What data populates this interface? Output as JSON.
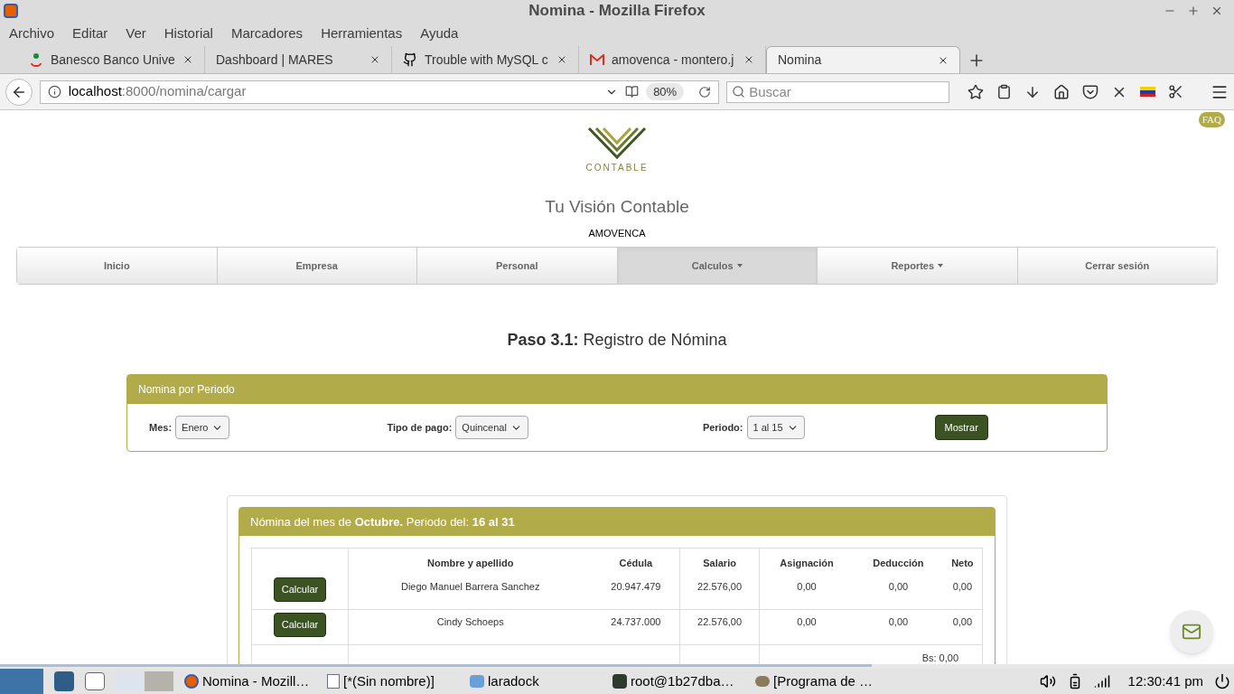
{
  "window": {
    "title": "Nomina - Mozilla Firefox"
  },
  "menu": [
    "Archivo",
    "Editar",
    "Ver",
    "Historial",
    "Marcadores",
    "Herramientas",
    "Ayuda"
  ],
  "tabs": [
    {
      "label": "Banesco Banco Unive",
      "kind": "bank",
      "selected": false
    },
    {
      "label": "Dashboard | MARES",
      "kind": "plain",
      "selected": false
    },
    {
      "label": "Trouble with MySQL c",
      "kind": "code",
      "selected": false
    },
    {
      "label": "amovenca - montero.j",
      "kind": "mail",
      "selected": false
    },
    {
      "label": "Nomina",
      "kind": "plain",
      "selected": true
    }
  ],
  "address_bar": {
    "host": "localhost",
    "path": ":8000/nomina/cargar",
    "zoom": "80%"
  },
  "search": {
    "placeholder": "Buscar"
  },
  "page": {
    "faq": "FAQ",
    "logo_text": "CONTABLE",
    "site_title": "Tu Visión Contable",
    "company": "AMOVENCA",
    "nav": [
      {
        "label": "Inicio",
        "dropdown": false,
        "selected": false
      },
      {
        "label": "Empresa",
        "dropdown": false,
        "selected": false
      },
      {
        "label": "Personal",
        "dropdown": false,
        "selected": false
      },
      {
        "label": "Calculos",
        "dropdown": true,
        "selected": true
      },
      {
        "label": "Reportes",
        "dropdown": true,
        "selected": false
      },
      {
        "label": "Cerrar sesión",
        "dropdown": false,
        "selected": false
      }
    ],
    "heading_bold": "Paso 3.1:",
    "heading": "Registro de Nómina",
    "filter_panel": {
      "title": "Nomina por Periodo",
      "fields": [
        {
          "label": "Mes:",
          "value": "Enero"
        },
        {
          "label": "Tipo de pago:",
          "value": "Quincenal"
        },
        {
          "label": "Periodo:",
          "value": "1 al 15"
        }
      ],
      "button": "Mostrar"
    },
    "results": {
      "title": "Nómina del mes de **Octubre.** Periodo del: **16 al 31**",
      "columns": [
        "Nombre y apellido",
        "Cédula",
        "Salario",
        "Asignación",
        "Deducción",
        "Neto"
      ],
      "rows": [
        {
          "action": "Calcular",
          "cells": [
            "Diego Manuel Barrera Sanchez",
            "20.947.479",
            "22.576,00",
            "0,00",
            "0,00",
            "0,00"
          ]
        },
        {
          "action": "Calcular",
          "cells": [
            "Cindy Schoeps",
            "24.737.000",
            "22.576,00",
            "0,00",
            "0,00",
            "0,00"
          ]
        }
      ],
      "total": "Bs: 0,00"
    }
  },
  "taskbar": {
    "items": [
      {
        "label": "Nomina - Mozill…",
        "kind": "browser"
      },
      {
        "label": "[*(Sin nombre)]",
        "kind": "editor"
      },
      {
        "label": "laradock",
        "kind": "folder"
      },
      {
        "label": "root@1b27dba…",
        "kind": "terminal"
      },
      {
        "label": "[Programa de …",
        "kind": "paint"
      }
    ],
    "clock": "12:30:41 pm"
  }
}
